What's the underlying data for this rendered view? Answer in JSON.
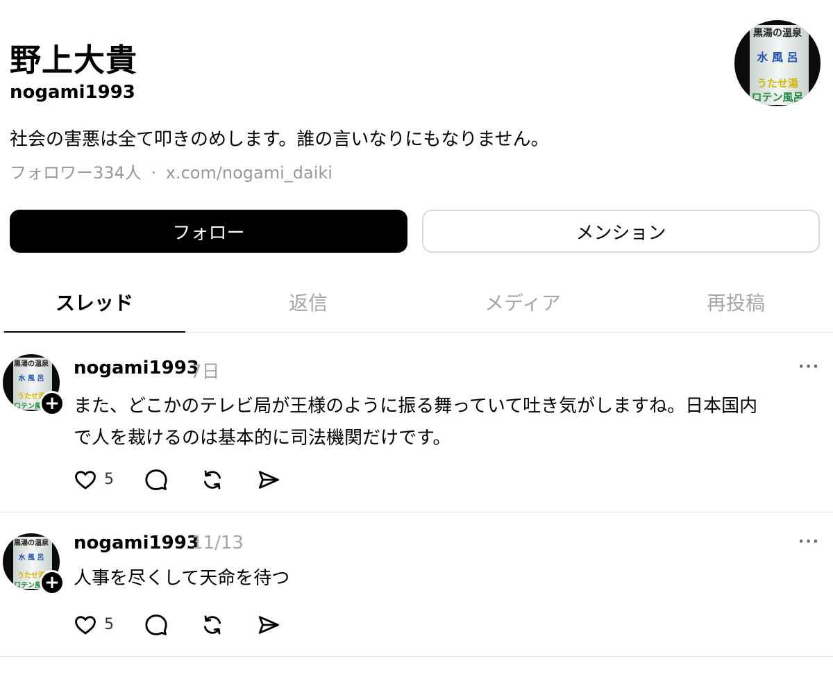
{
  "profile": {
    "display_name": "野上大貴",
    "handle": "nogami1993",
    "bio": "社会の害悪は全て叩きのめします。誰の言いなりにもなりません。",
    "followers": "フォロワー334人",
    "separator": "·",
    "link": "x.com/nogami_daiki",
    "avatar_sign_lines": [
      "黒湯の温泉",
      "水 風 呂",
      "うたせ湯",
      "ロテン風呂"
    ]
  },
  "actions": {
    "follow_label": "フォロー",
    "mention_label": "メンション"
  },
  "tabs": [
    {
      "label": "スレッド",
      "active": true
    },
    {
      "label": "返信",
      "active": false
    },
    {
      "label": "メディア",
      "active": false
    },
    {
      "label": "再投稿",
      "active": false
    }
  ],
  "posts": [
    {
      "author": "nogami1993",
      "time": "7日",
      "text_lines": [
        "また、どこかのテレビ局が王様のように振る舞っていて吐き気がしますね。日本国内",
        "で人を裁けるのは基本的に司法機関だけです。"
      ],
      "like_count": "5",
      "more": "···"
    },
    {
      "author": "nogami1993",
      "time": "11/13",
      "text_lines": [
        "人事を尽くして天命を待つ"
      ],
      "like_count": "5",
      "more": "···"
    }
  ],
  "icons": {
    "like": "heart-icon",
    "reply": "comment-icon",
    "repost": "repost-icon",
    "share": "send-icon",
    "follow_badge": "plus-icon"
  },
  "colors": {
    "primary": "#000000",
    "muted_text": "#999999",
    "divider": "#e3e3e3",
    "sign_blue": "#1f4fb5",
    "sign_yellow": "#d9b400",
    "sign_green": "#1e8a3a"
  }
}
